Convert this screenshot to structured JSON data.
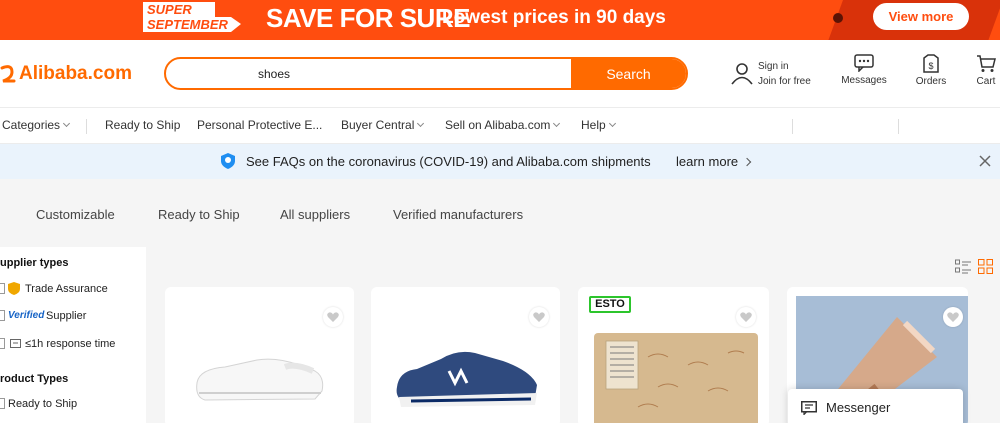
{
  "banner": {
    "badge_line1": "SUPER",
    "badge_line2": "SEPTEMBER",
    "headline": "SAVE FOR SURE",
    "subline": "Lowest prices in 90 days",
    "cta": "View more",
    "colors": {
      "background": "#ff4d0f",
      "accent": "#d9320a"
    }
  },
  "header": {
    "logo_mark": "→",
    "logo_text": "Alibaba.com",
    "search": {
      "value": "shoes",
      "placeholder": "",
      "button_label": "Search"
    },
    "signin": {
      "line1": "Sign in",
      "line2": "Join for free"
    },
    "messages_label": "Messages",
    "orders_label": "Orders",
    "cart_label": "Cart",
    "brand_color": "#ff6a00"
  },
  "nav": {
    "items": [
      {
        "label": "Categories"
      },
      {
        "label": "Ready to Ship"
      },
      {
        "label": "Personal Protective E..."
      },
      {
        "label": "Buyer Central"
      },
      {
        "label": "Sell on Alibaba.com"
      },
      {
        "label": "Help"
      }
    ]
  },
  "notice": {
    "text": "See FAQs on the coronavirus (COVID-19) and Alibaba.com shipments",
    "link": "learn more",
    "icon": "shield-icon"
  },
  "filter_tabs": [
    "Customizable",
    "Ready to Ship",
    "All suppliers",
    "Verified manufacturers"
  ],
  "sidebar": {
    "supplier_types_heading": "upplier types",
    "supplier_types": [
      {
        "label": "Trade Assurance",
        "icon": "trade-assurance-icon"
      },
      {
        "label": "Supplier",
        "prefix": "Verified"
      },
      {
        "label": "≤1h response time",
        "icon": "chat-icon"
      }
    ],
    "product_types_heading": "roduct Types",
    "product_types": [
      {
        "label": "Ready to Ship"
      }
    ]
  },
  "products": [
    {
      "image": "white-sneaker",
      "favorite_icon": "heart-icon"
    },
    {
      "image": "blue-running-shoe",
      "favorite_icon": "heart-icon"
    },
    {
      "image": "shoe-box-packaging",
      "badge": "ESTO",
      "favorite_icon": "heart-icon"
    },
    {
      "image": "copper-tube",
      "favorite_icon": "heart-icon"
    }
  ],
  "messenger": {
    "label": "Messenger"
  }
}
